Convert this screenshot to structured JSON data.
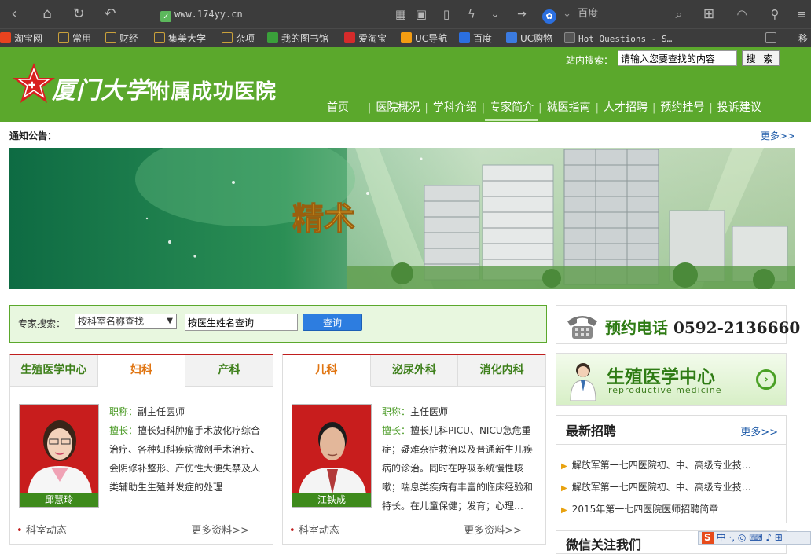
{
  "browser": {
    "url": "www.174yy.cn",
    "search_engine": "百度",
    "bookmarks": [
      "淘宝网",
      "常用",
      "财经",
      "集美大学",
      "杂项",
      "我的图书馆",
      "爱淘宝",
      "UC导航",
      "百度",
      "UC购物",
      "Hot Questions - S…",
      "移"
    ]
  },
  "header": {
    "logo_script": "厦门大学",
    "logo_rest": "附属成功医院",
    "site_search_label": "站内搜索：",
    "site_search_value": "请输入您要查找的内容",
    "site_search_button": "搜 索",
    "nav": [
      "首页",
      "医院概况",
      "学科介绍",
      "专家简介",
      "就医指南",
      "人才招聘",
      "预约挂号",
      "投诉建议"
    ],
    "active_nav": "专家简介"
  },
  "notice": {
    "label": "通知公告：",
    "more": "更多>>"
  },
  "banner": {
    "text": "精术"
  },
  "expert_search": {
    "label": "专家搜索：",
    "dept_select": "按科室名称查找",
    "name_placeholder": "按医生姓名查询",
    "button": "查询"
  },
  "panel_left": {
    "tabs": [
      "生殖医学中心",
      "妇科",
      "产科"
    ],
    "active_tab": "妇科",
    "doctor_name": "邱慧玲",
    "title_label": "职称：",
    "title_value": "副主任医师",
    "specialty_label": "擅长：",
    "specialty_value": "擅长妇科肿瘤手术放化疗综合治疗、各种妇科疾病微创手术治疗、会阴修补整形、产伤性大便失禁及人类辅助生生殖并发症的处理",
    "footer_label": "科室动态",
    "footer_more": "更多资料>>"
  },
  "panel_right": {
    "tabs": [
      "儿科",
      "泌尿外科",
      "消化内科"
    ],
    "active_tab": "儿科",
    "doctor_name": "江铁成",
    "title_label": "职称：",
    "title_value": "主任医师",
    "specialty_label": "擅长：",
    "specialty_value": "擅长儿科PICU、NICU急危重症；疑难杂症救治以及普通新生儿疾病的诊治。同时在呼吸系统慢性咳嗽；喘息类疾病有丰富的临床经验和特长。在儿童保健；发育；心理…",
    "footer_label": "科室动态",
    "footer_more": "更多资料>>"
  },
  "sidebar": {
    "phone_label": "预约电话",
    "phone_number": "0592-2136660",
    "repro_title": "生殖医学中心",
    "repro_subtitle": "reproductive medicine",
    "jobs_title": "最新招聘",
    "jobs_more": "更多>>",
    "jobs": [
      "解放军第一七四医院初、中、高级专业技…",
      "解放军第一七四医院初、中、高级专业技…",
      "2015年第一七四医院医师招聘简章"
    ],
    "wechat_title": "微信关注我们"
  },
  "ime": {
    "text": "中 ·, ◎ ⌨ ♪ ⊞"
  },
  "colors": {
    "green": "#5ba82c",
    "red": "#c01e1e",
    "orange": "#e07410",
    "link": "#1d5aa8"
  }
}
